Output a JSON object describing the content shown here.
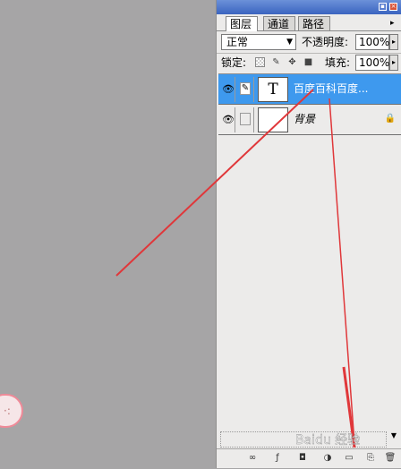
{
  "layers_panel": {
    "tabs": [
      "图层",
      "通道",
      "路径"
    ],
    "blend_mode": "正常",
    "opacity_label": "不透明度:",
    "opacity_value": "100%",
    "lock_label": "锁定:",
    "fill_label": "填充:",
    "fill_value": "100%",
    "layers": [
      {
        "thumb": "T",
        "name": "百度百科百度...",
        "selected": true
      },
      {
        "thumb": "",
        "name": "背景",
        "selected": false,
        "locked": true
      }
    ]
  },
  "watermark": "Baidu 经验",
  "annotation_color": "#e0373a"
}
